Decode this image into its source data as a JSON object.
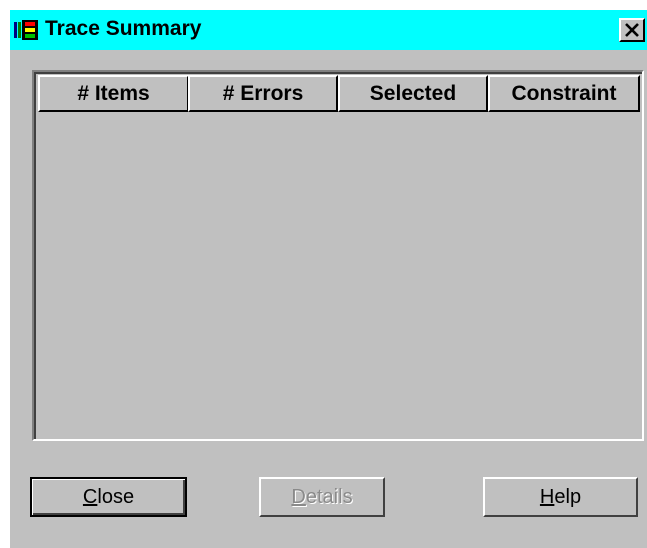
{
  "window": {
    "title": "Trace Summary",
    "icon": "trace-app-icon",
    "close_icon": "close-x-icon"
  },
  "table": {
    "columns": [
      "# Items",
      "# Errors",
      "Selected",
      "Constraint"
    ],
    "rows": []
  },
  "buttons": {
    "close": {
      "mnemonic": "C",
      "rest": "lose",
      "enabled": true,
      "default": true
    },
    "details": {
      "mnemonic": "D",
      "rest": "etails",
      "enabled": false
    },
    "help": {
      "mnemonic": "H",
      "rest": "elp",
      "enabled": true
    }
  },
  "colors": {
    "titlebar": "#00ffff",
    "dialog_face": "#c0c0c0",
    "disabled_text": "#8a8a8a"
  }
}
